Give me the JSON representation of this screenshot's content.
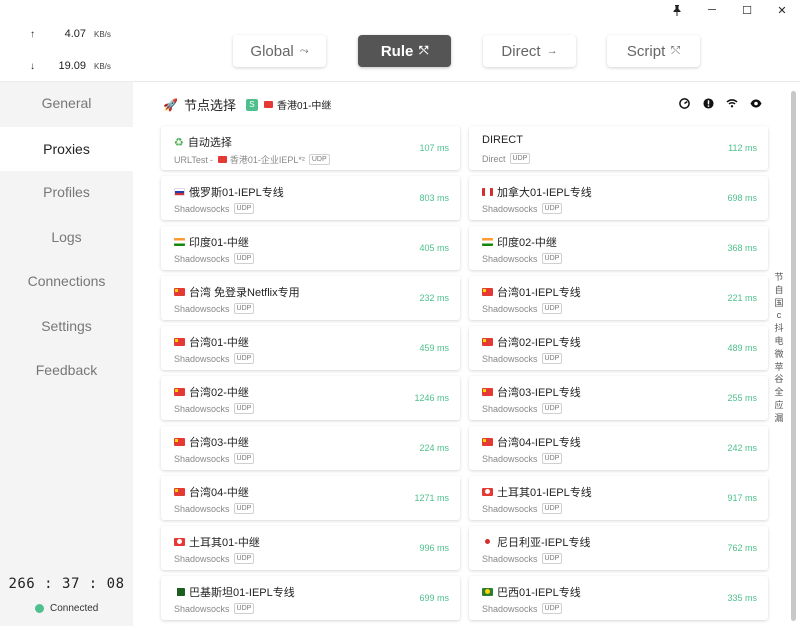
{
  "window": {
    "pin_icon": "pin-icon",
    "minimize": "─",
    "maximize": "☐",
    "close": "✕"
  },
  "traffic": {
    "up_arrow": "↑",
    "up_value": "4.07",
    "up_unit": "KB/s",
    "down_arrow": "↓",
    "down_value": "19.09",
    "down_unit": "KB/s"
  },
  "sidebar": {
    "items": [
      {
        "label": "General"
      },
      {
        "label": "Proxies"
      },
      {
        "label": "Profiles"
      },
      {
        "label": "Logs"
      },
      {
        "label": "Connections"
      },
      {
        "label": "Settings"
      },
      {
        "label": "Feedback"
      }
    ],
    "active": "Proxies",
    "timer": "266 : 37 : 08",
    "status": "Connected",
    "status_color": "#4fc08d"
  },
  "modes": [
    {
      "label": "Global",
      "icon": "⤳"
    },
    {
      "label": "Rule",
      "icon": "⤲"
    },
    {
      "label": "Direct",
      "icon": "→"
    },
    {
      "label": "Script",
      "icon": "⤲"
    }
  ],
  "active_mode": "Rule",
  "group": {
    "icon": "🚀",
    "title": "节点选择",
    "type_badge": "S",
    "selected": "香港01-中继"
  },
  "header_icons": [
    "speedtest-icon",
    "info-icon",
    "wifi-icon",
    "eye-icon"
  ],
  "latency_color": "#4fc08d",
  "proxies": [
    {
      "name": "自动选择",
      "flag": "recycle",
      "type": "URLTest",
      "extra": "香港01-企业IEPL*²",
      "udp": "UDP",
      "latency": "107 ms"
    },
    {
      "name": "DIRECT",
      "flag": "",
      "type": "Direct",
      "extra": "",
      "udp": "UDP",
      "latency": "112 ms"
    },
    {
      "name": "俄罗斯01-IEPL专线",
      "flag": "ru",
      "type": "Shadowsocks",
      "extra": "",
      "udp": "UDP",
      "latency": "803 ms"
    },
    {
      "name": "加拿大01-IEPL专线",
      "flag": "ca",
      "type": "Shadowsocks",
      "extra": "",
      "udp": "UDP",
      "latency": "698 ms"
    },
    {
      "name": "印度01-中继",
      "flag": "in",
      "type": "Shadowsocks",
      "extra": "",
      "udp": "UDP",
      "latency": "405 ms"
    },
    {
      "name": "印度02-中继",
      "flag": "in",
      "type": "Shadowsocks",
      "extra": "",
      "udp": "UDP",
      "latency": "368 ms"
    },
    {
      "name": "台湾 免登录Netflix专用",
      "flag": "cn",
      "type": "Shadowsocks",
      "extra": "",
      "udp": "UDP",
      "latency": "232 ms"
    },
    {
      "name": "台湾01-IEPL专线",
      "flag": "cn",
      "type": "Shadowsocks",
      "extra": "",
      "udp": "UDP",
      "latency": "221 ms"
    },
    {
      "name": "台湾01-中继",
      "flag": "cn",
      "type": "Shadowsocks",
      "extra": "",
      "udp": "UDP",
      "latency": "459 ms"
    },
    {
      "name": "台湾02-IEPL专线",
      "flag": "cn",
      "type": "Shadowsocks",
      "extra": "",
      "udp": "UDP",
      "latency": "489 ms"
    },
    {
      "name": "台湾02-中继",
      "flag": "cn",
      "type": "Shadowsocks",
      "extra": "",
      "udp": "UDP",
      "latency": "1246 ms"
    },
    {
      "name": "台湾03-IEPL专线",
      "flag": "cn",
      "type": "Shadowsocks",
      "extra": "",
      "udp": "UDP",
      "latency": "255 ms"
    },
    {
      "name": "台湾03-中继",
      "flag": "cn",
      "type": "Shadowsocks",
      "extra": "",
      "udp": "UDP",
      "latency": "224 ms"
    },
    {
      "name": "台湾04-IEPL专线",
      "flag": "cn",
      "type": "Shadowsocks",
      "extra": "",
      "udp": "UDP",
      "latency": "242 ms"
    },
    {
      "name": "台湾04-中继",
      "flag": "cn",
      "type": "Shadowsocks",
      "extra": "",
      "udp": "UDP",
      "latency": "1271 ms"
    },
    {
      "name": "土耳其01-IEPL专线",
      "flag": "tr",
      "type": "Shadowsocks",
      "extra": "",
      "udp": "UDP",
      "latency": "917 ms"
    },
    {
      "name": "土耳其01-中继",
      "flag": "tr",
      "type": "Shadowsocks",
      "extra": "",
      "udp": "UDP",
      "latency": "996 ms"
    },
    {
      "name": "尼日利亚-IEPL专线",
      "flag": "ng",
      "type": "Shadowsocks",
      "extra": "",
      "udp": "UDP",
      "latency": "762 ms"
    },
    {
      "name": "巴基斯坦01-IEPL专线",
      "flag": "pk",
      "type": "Shadowsocks",
      "extra": "",
      "udp": "UDP",
      "latency": "699 ms"
    },
    {
      "name": "巴西01-IEPL专线",
      "flag": "br",
      "type": "Shadowsocks",
      "extra": "",
      "udp": "UDP",
      "latency": "335 ms"
    }
  ],
  "side_text": [
    "节",
    "自",
    "国",
    "c",
    "抖",
    "电",
    "微",
    "苹",
    "谷",
    "全",
    "应",
    "漏"
  ]
}
